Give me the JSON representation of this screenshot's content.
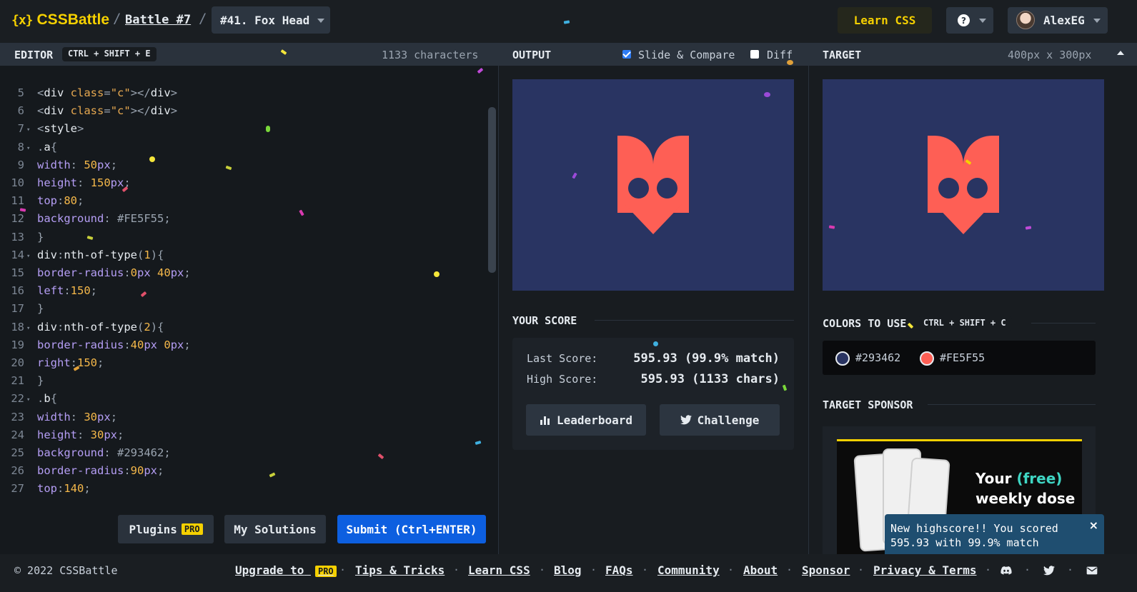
{
  "header": {
    "logo_mark": "{x}",
    "logo_text": "CSSBattle",
    "battle_link": "Battle #7",
    "target_select": "#41. Fox Head",
    "learn_button": "Learn CSS",
    "help_icon": "?",
    "username": "AlexEG"
  },
  "editor": {
    "title": "EDITOR",
    "shortcut": "CTRL + SHIFT + E",
    "char_count": "1133 characters",
    "lines": [
      {
        "n": "5",
        "fold": false,
        "parts": [
          [
            "t-punc",
            "<"
          ],
          [
            "t-tag",
            "div "
          ],
          [
            "t-attr",
            "class"
          ],
          [
            "t-punc",
            "="
          ],
          [
            "t-str",
            "\"c\""
          ],
          [
            "t-punc",
            "></"
          ],
          [
            "t-tag",
            "div"
          ],
          [
            "t-punc",
            ">"
          ]
        ]
      },
      {
        "n": "6",
        "fold": false,
        "parts": [
          [
            "t-punc",
            "<"
          ],
          [
            "t-tag",
            "div "
          ],
          [
            "t-attr",
            "class"
          ],
          [
            "t-punc",
            "="
          ],
          [
            "t-str",
            "\"c\""
          ],
          [
            "t-punc",
            "></"
          ],
          [
            "t-tag",
            "div"
          ],
          [
            "t-punc",
            ">"
          ]
        ]
      },
      {
        "n": "7",
        "fold": true,
        "parts": [
          [
            "t-punc",
            "<"
          ],
          [
            "t-tag",
            "style"
          ],
          [
            "t-punc",
            ">"
          ]
        ]
      },
      {
        "n": "8",
        "fold": true,
        "parts": [
          [
            "t-punc",
            "."
          ],
          [
            "t-sel",
            "a"
          ],
          [
            "t-punc",
            "{"
          ]
        ]
      },
      {
        "n": "9",
        "fold": false,
        "parts": [
          [
            "t-prop",
            "width"
          ],
          [
            "t-punc",
            ": "
          ],
          [
            "t-num",
            "50"
          ],
          [
            "t-prop",
            "px"
          ],
          [
            "t-punc",
            ";"
          ]
        ]
      },
      {
        "n": "10",
        "fold": false,
        "parts": [
          [
            "t-prop",
            "height"
          ],
          [
            "t-punc",
            ": "
          ],
          [
            "t-num",
            "150"
          ],
          [
            "t-prop",
            "px"
          ],
          [
            "t-punc",
            ";"
          ]
        ]
      },
      {
        "n": "11",
        "fold": false,
        "parts": [
          [
            "t-prop",
            "top"
          ],
          [
            "t-punc",
            ":"
          ],
          [
            "t-num",
            "80"
          ],
          [
            "t-punc",
            ";"
          ]
        ]
      },
      {
        "n": "12",
        "fold": false,
        "parts": [
          [
            "t-prop",
            "background"
          ],
          [
            "t-punc",
            ": "
          ],
          [
            "t-hex",
            "#FE5F55"
          ],
          [
            "t-punc",
            ";"
          ]
        ]
      },
      {
        "n": "13",
        "fold": false,
        "parts": [
          [
            "t-punc",
            "}"
          ]
        ]
      },
      {
        "n": "14",
        "fold": true,
        "parts": [
          [
            "t-sel",
            "div"
          ],
          [
            "t-punc",
            ":"
          ],
          [
            "t-sel",
            "nth-of-type"
          ],
          [
            "t-punc",
            "("
          ],
          [
            "t-num",
            "1"
          ],
          [
            "t-punc",
            "){"
          ]
        ]
      },
      {
        "n": "15",
        "fold": false,
        "parts": [
          [
            "t-prop",
            "border-radius"
          ],
          [
            "t-punc",
            ":"
          ],
          [
            "t-num",
            "0"
          ],
          [
            "t-prop",
            "px "
          ],
          [
            "t-num",
            "40"
          ],
          [
            "t-prop",
            "px"
          ],
          [
            "t-punc",
            ";"
          ]
        ]
      },
      {
        "n": "16",
        "fold": false,
        "parts": [
          [
            "t-prop",
            "left"
          ],
          [
            "t-punc",
            ":"
          ],
          [
            "t-num",
            "150"
          ],
          [
            "t-punc",
            ";"
          ]
        ]
      },
      {
        "n": "17",
        "fold": false,
        "parts": [
          [
            "t-punc",
            "}"
          ]
        ]
      },
      {
        "n": "18",
        "fold": true,
        "parts": [
          [
            "t-sel",
            "div"
          ],
          [
            "t-punc",
            ":"
          ],
          [
            "t-sel",
            "nth-of-type"
          ],
          [
            "t-punc",
            "("
          ],
          [
            "t-num",
            "2"
          ],
          [
            "t-punc",
            "){"
          ]
        ]
      },
      {
        "n": "19",
        "fold": false,
        "parts": [
          [
            "t-prop",
            "border-radius"
          ],
          [
            "t-punc",
            ":"
          ],
          [
            "t-num",
            "40"
          ],
          [
            "t-prop",
            "px "
          ],
          [
            "t-num",
            "0"
          ],
          [
            "t-prop",
            "px"
          ],
          [
            "t-punc",
            ";"
          ]
        ]
      },
      {
        "n": "20",
        "fold": false,
        "parts": [
          [
            "t-prop",
            "right"
          ],
          [
            "t-punc",
            ":"
          ],
          [
            "t-num",
            "150"
          ],
          [
            "t-punc",
            ";"
          ]
        ]
      },
      {
        "n": "21",
        "fold": false,
        "parts": [
          [
            "t-punc",
            "}"
          ]
        ]
      },
      {
        "n": "22",
        "fold": true,
        "parts": [
          [
            "t-punc",
            "."
          ],
          [
            "t-sel",
            "b"
          ],
          [
            "t-punc",
            "{"
          ]
        ]
      },
      {
        "n": "23",
        "fold": false,
        "parts": [
          [
            "t-prop",
            "width"
          ],
          [
            "t-punc",
            ": "
          ],
          [
            "t-num",
            "30"
          ],
          [
            "t-prop",
            "px"
          ],
          [
            "t-punc",
            ";"
          ]
        ]
      },
      {
        "n": "24",
        "fold": false,
        "parts": [
          [
            "t-prop",
            "height"
          ],
          [
            "t-punc",
            ": "
          ],
          [
            "t-num",
            "30"
          ],
          [
            "t-prop",
            "px"
          ],
          [
            "t-punc",
            ";"
          ]
        ]
      },
      {
        "n": "25",
        "fold": false,
        "parts": [
          [
            "t-prop",
            "background"
          ],
          [
            "t-punc",
            ": "
          ],
          [
            "t-hex",
            "#293462"
          ],
          [
            "t-punc",
            ";"
          ]
        ]
      },
      {
        "n": "26",
        "fold": false,
        "parts": [
          [
            "t-prop",
            "border-radius"
          ],
          [
            "t-punc",
            ":"
          ],
          [
            "t-num",
            "90"
          ],
          [
            "t-prop",
            "px"
          ],
          [
            "t-punc",
            ";"
          ]
        ]
      },
      {
        "n": "27",
        "fold": false,
        "parts": [
          [
            "t-prop",
            "top"
          ],
          [
            "t-punc",
            ":"
          ],
          [
            "t-num",
            "140"
          ],
          [
            "t-punc",
            ";"
          ]
        ]
      }
    ],
    "plugins_button": "Plugins",
    "pro_badge": "PRO",
    "my_solutions_button": "My Solutions",
    "submit_button": "Submit (Ctrl+ENTER)"
  },
  "output": {
    "title": "OUTPUT",
    "slide_compare_label": "Slide & Compare",
    "slide_compare_checked": true,
    "diff_label": "Diff",
    "diff_checked": false
  },
  "score": {
    "title": "YOUR SCORE",
    "last_label": "Last Score:",
    "last_value": "595.93 (99.9% match)",
    "high_label": "High Score:",
    "high_value": "595.93 (1133 chars)",
    "leaderboard_button": "Leaderboard",
    "challenge_button": "Challenge"
  },
  "target": {
    "title": "TARGET",
    "size": "400px x 300px",
    "colors_title": "COLORS TO USE",
    "colors_shortcut": "CTRL + SHIFT + C",
    "colors": [
      {
        "hex": "#293462",
        "label": "#293462"
      },
      {
        "hex": "#FE5F55",
        "label": "#FE5F55"
      }
    ],
    "sponsor_title": "TARGET SPONSOR",
    "sponsor_line1": "Your",
    "sponsor_free": "(free)",
    "sponsor_line2": "weekly dose"
  },
  "toast": {
    "message": "New highscore!! You scored 595.93 with 99.9% match",
    "close": "×"
  },
  "footer": {
    "copyright": "© 2022 CSSBattle",
    "upgrade": "Upgrade to",
    "upgrade_badge": "PRO",
    "links": [
      "Tips & Tricks",
      "Learn CSS",
      "Blog",
      "FAQs",
      "Community",
      "About",
      "Sponsor",
      "Privacy & Terms"
    ]
  },
  "colors": {
    "accent": "#f5d000",
    "primary_button": "#0d5fe0",
    "canvas_bg": "#293462",
    "fox": "#FE5F55"
  }
}
